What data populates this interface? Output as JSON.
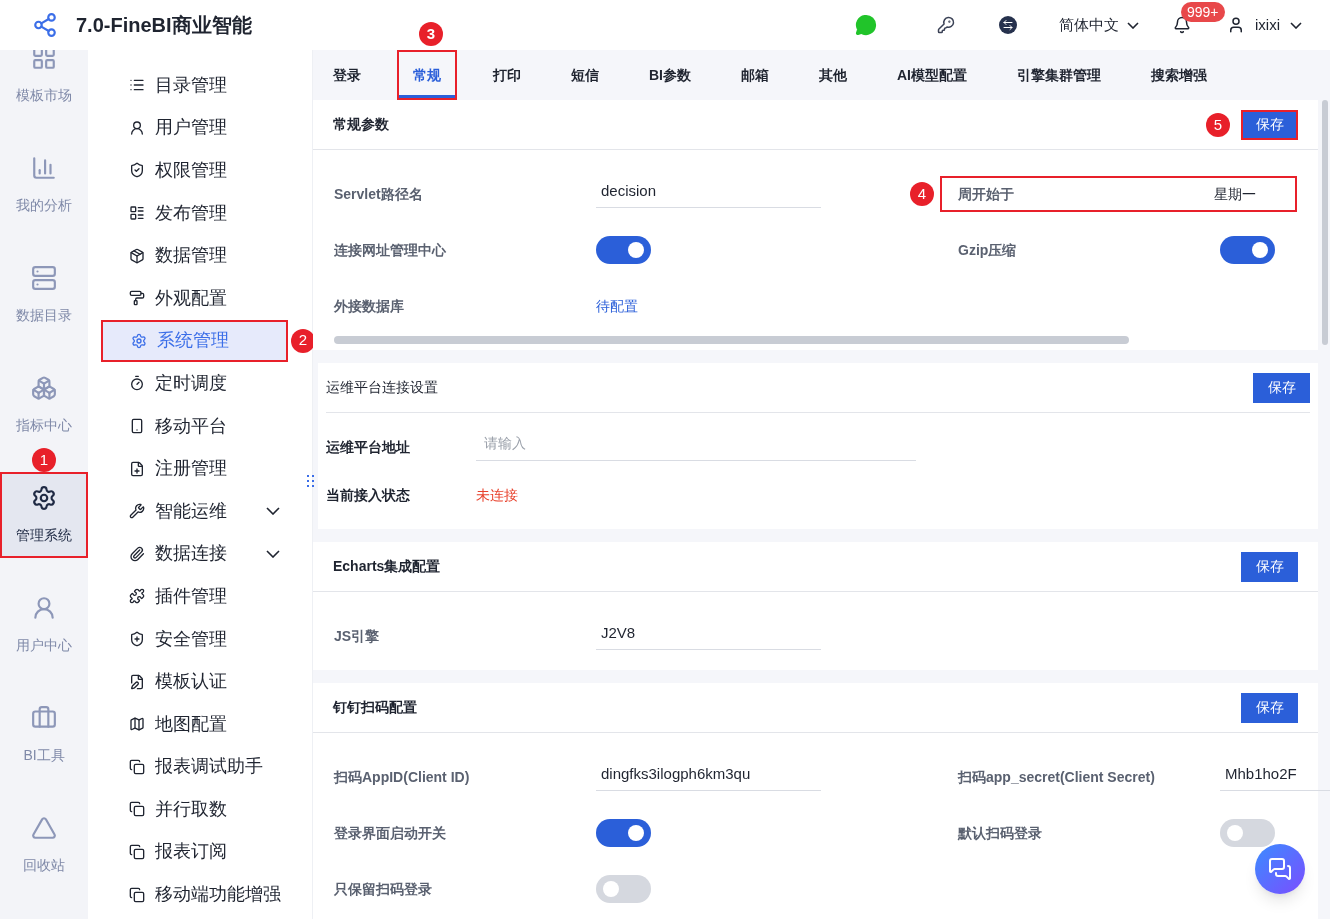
{
  "header": {
    "title": "7.0-FineBI商业智能",
    "language": "简体中文",
    "notification_badge": "999+",
    "user": "ixixi"
  },
  "rail": [
    {
      "label": "模板市场",
      "selected": false
    },
    {
      "label": "我的分析",
      "selected": false
    },
    {
      "label": "数据目录",
      "selected": false
    },
    {
      "label": "指标中心",
      "selected": false
    },
    {
      "label": "管理系统",
      "selected": true,
      "highlighted": true,
      "annotation": "1"
    },
    {
      "label": "用户中心",
      "selected": false
    },
    {
      "label": "BI工具",
      "selected": false
    },
    {
      "label": "回收站",
      "selected": false
    }
  ],
  "menu": [
    {
      "label": "目录管理",
      "selected": false,
      "expandable": false
    },
    {
      "label": "用户管理",
      "selected": false,
      "expandable": false
    },
    {
      "label": "权限管理",
      "selected": false,
      "expandable": false
    },
    {
      "label": "发布管理",
      "selected": false,
      "expandable": false
    },
    {
      "label": "数据管理",
      "selected": false,
      "expandable": false
    },
    {
      "label": "外观配置",
      "selected": false,
      "expandable": false
    },
    {
      "label": "系统管理",
      "selected": true,
      "expandable": false,
      "highlighted": true,
      "annotation": "2"
    },
    {
      "label": "定时调度",
      "selected": false,
      "expandable": false
    },
    {
      "label": "移动平台",
      "selected": false,
      "expandable": false
    },
    {
      "label": "注册管理",
      "selected": false,
      "expandable": false
    },
    {
      "label": "智能运维",
      "selected": false,
      "expandable": true
    },
    {
      "label": "数据连接",
      "selected": false,
      "expandable": true
    },
    {
      "label": "插件管理",
      "selected": false,
      "expandable": false
    },
    {
      "label": "安全管理",
      "selected": false,
      "expandable": false
    },
    {
      "label": "模板认证",
      "selected": false,
      "expandable": false
    },
    {
      "label": "地图配置",
      "selected": false,
      "expandable": false
    },
    {
      "label": "报表调试助手",
      "selected": false,
      "expandable": false
    },
    {
      "label": "并行取数",
      "selected": false,
      "expandable": false
    },
    {
      "label": "报表订阅",
      "selected": false,
      "expandable": false
    },
    {
      "label": "移动端功能增强",
      "selected": false,
      "expandable": false
    }
  ],
  "tabs": [
    {
      "label": "登录",
      "selected": false
    },
    {
      "label": "常规",
      "selected": true,
      "highlighted": true,
      "annotation": "3"
    },
    {
      "label": "打印",
      "selected": false
    },
    {
      "label": "短信",
      "selected": false
    },
    {
      "label": "BI参数",
      "selected": false
    },
    {
      "label": "邮箱",
      "selected": false
    },
    {
      "label": "其他",
      "selected": false
    },
    {
      "label": "AI模型配置",
      "selected": false
    },
    {
      "label": "引擎集群管理",
      "selected": false
    },
    {
      "label": "搜索增强",
      "selected": false
    }
  ],
  "sections": [
    {
      "kind": "card",
      "title": "常规参数",
      "save_button": {
        "label": "保存",
        "highlighted": true,
        "annotation": "5"
      },
      "rows": [
        [
          {
            "kind": "text",
            "label": "Servlet路径名",
            "value": "decision"
          },
          {
            "kind": "text",
            "label": "周开始于",
            "value": "星期一",
            "highlighted": true,
            "annotation": "4"
          }
        ],
        [
          {
            "kind": "toggle",
            "label": "连接网址管理中心",
            "on": true
          },
          {
            "kind": "toggle",
            "label": "Gzip压缩",
            "on": true
          }
        ],
        [
          {
            "kind": "link",
            "label": "外接数据库",
            "value": "待配置"
          }
        ]
      ]
    },
    {
      "kind": "inset",
      "title": "运维平台连接设置",
      "save_button": {
        "label": "保存",
        "highlighted": false
      },
      "rows": [
        [
          {
            "kind": "input",
            "label": "运维平台地址",
            "placeholder": "请输入"
          }
        ],
        [
          {
            "kind": "status",
            "label": "当前接入状态",
            "value": "未连接"
          }
        ]
      ]
    },
    {
      "kind": "card",
      "title": "Echarts集成配置",
      "save_button": {
        "label": "保存",
        "highlighted": false
      },
      "rows": [
        [
          {
            "kind": "text",
            "label": "JS引擎",
            "value": "J2V8"
          }
        ]
      ]
    },
    {
      "kind": "card",
      "title": "钉钉扫码配置",
      "save_button": {
        "label": "保存",
        "highlighted": false
      },
      "rows": [
        [
          {
            "kind": "text",
            "label": "扫码AppID(Client ID)",
            "value": "dingfks3ilogph6km3qu"
          },
          {
            "kind": "text",
            "label": "扫码app_secret(Client Secret)",
            "value": "Mhb1ho2F"
          }
        ],
        [
          {
            "kind": "toggle",
            "label": "登录界面启动开关",
            "on": true
          },
          {
            "kind": "toggle",
            "label": "默认扫码登录",
            "on": false
          }
        ],
        [
          {
            "kind": "toggle",
            "label": "只保留扫码登录",
            "on": false
          }
        ]
      ]
    }
  ]
}
